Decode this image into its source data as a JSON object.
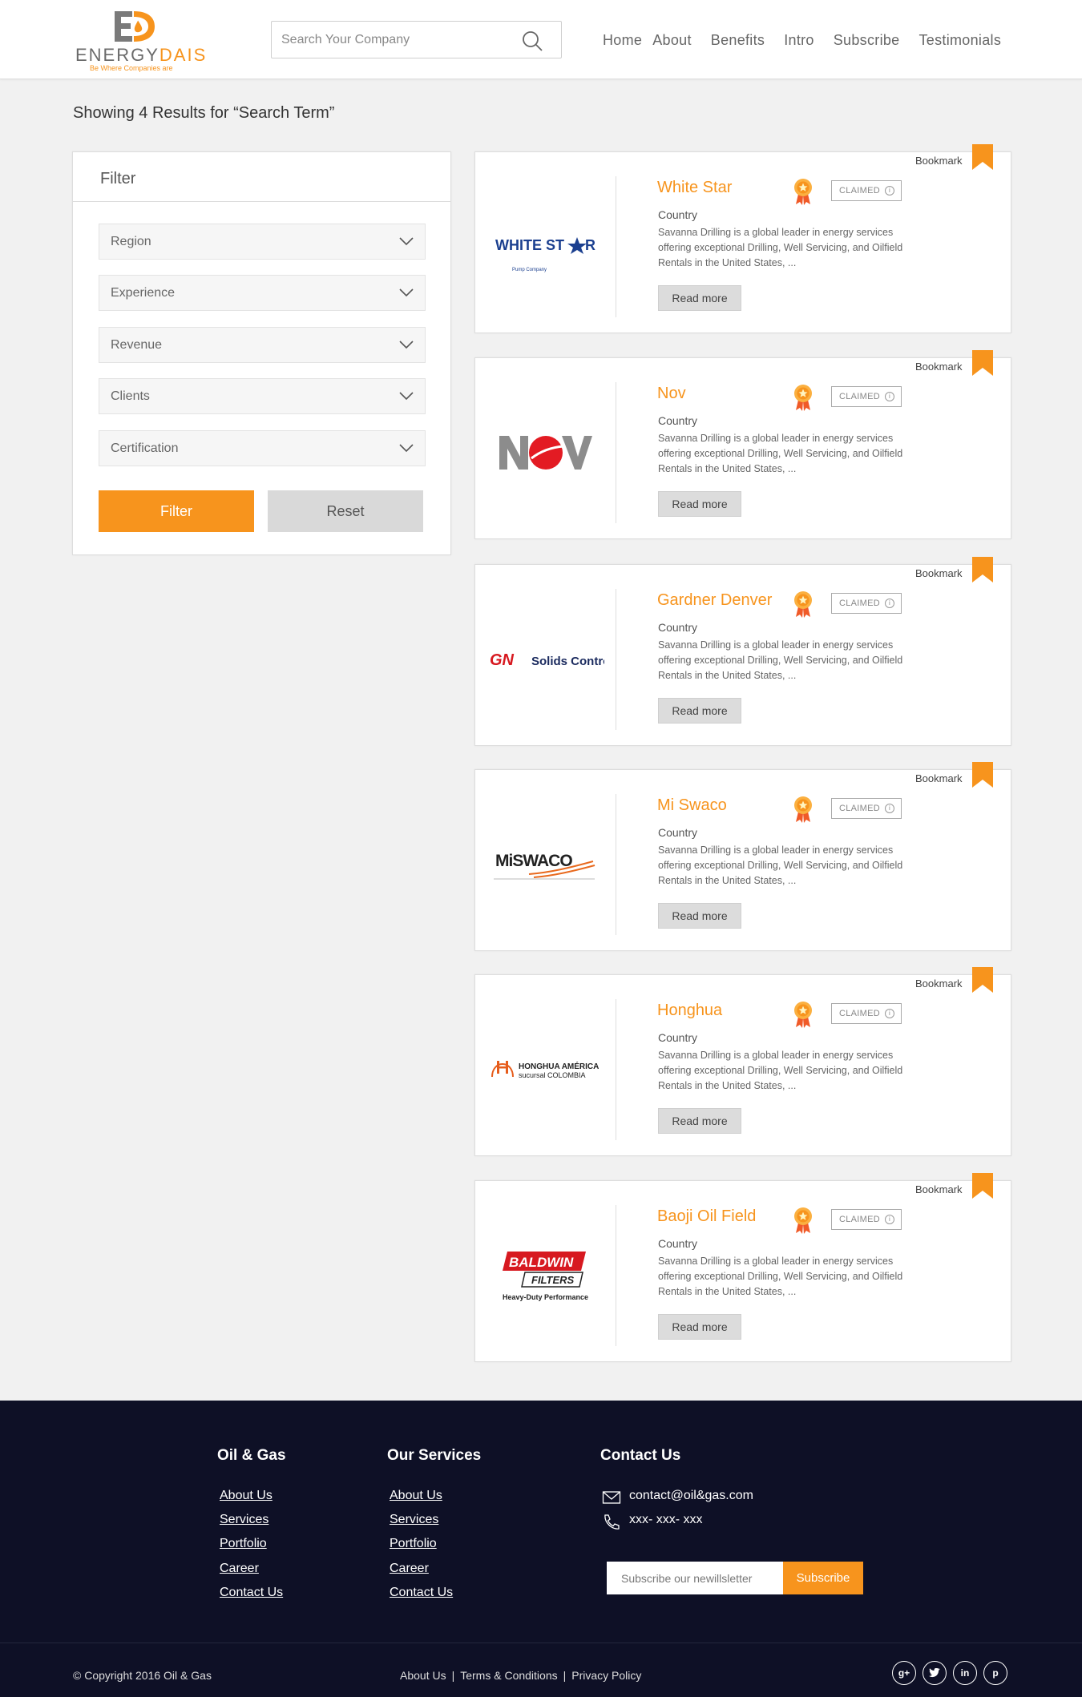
{
  "header": {
    "logo": {
      "brand_main": "ENERGY",
      "brand_accent": "DAIS",
      "tagline": "Be Where Companies are"
    },
    "search": {
      "placeholder": "Search Your Company",
      "icon": "search-icon"
    },
    "nav": [
      "Home",
      "About",
      "Benefits",
      "Intro",
      "Subscribe",
      "Testimonials"
    ]
  },
  "results_heading": "Showing 4 Results for “Search Term”",
  "filter": {
    "title": "Filter",
    "selects": [
      "Region",
      "Experience",
      "Revenue",
      "Clients",
      "Certification"
    ],
    "filter_button": "Filter",
    "reset_button": "Reset"
  },
  "cards": [
    {
      "name": "White Star",
      "country": "Country",
      "claimed": "CLAIMED",
      "bookmark": "Bookmark",
      "read_more": "Read more",
      "logo_text": "WHITE STAR",
      "logo_sub": "Pump Company",
      "description": "Savanna Drilling is a global leader in energy services offering exceptional Drilling, Well Servicing, and Oilfield Rentals in the United States, ..."
    },
    {
      "name": "Nov",
      "country": "Country",
      "claimed": "CLAIMED",
      "bookmark": "Bookmark",
      "read_more": "Read more",
      "logo_text": "NOV",
      "logo_sub": "",
      "description": "Savanna Drilling is a global leader in energy services offering exceptional Drilling, Well Servicing, and Oilfield Rentals in the United States, ..."
    },
    {
      "name": "Gardner Denver",
      "country": "Country",
      "claimed": "CLAIMED",
      "bookmark": "Bookmark",
      "read_more": "Read more",
      "logo_text": "GN",
      "logo_sub": "Solids Control",
      "description": "Savanna Drilling is a global leader in energy services offering exceptional Drilling, Well Servicing, and Oilfield Rentals in the United States, ..."
    },
    {
      "name": "Mi Swaco",
      "country": "Country",
      "claimed": "CLAIMED",
      "bookmark": "Bookmark",
      "read_more": "Read more",
      "logo_text": "MiSWACO",
      "logo_sub": "",
      "description": "Savanna Drilling is a global leader in energy services offering exceptional Drilling, Well Servicing, and Oilfield Rentals in the United States, ..."
    },
    {
      "name": "Honghua",
      "country": "Country",
      "claimed": "CLAIMED",
      "bookmark": "Bookmark",
      "read_more": "Read more",
      "logo_text": "HONGHUA AMÉRICA",
      "logo_sub": "sucursal COLOMBIA",
      "description": "Savanna Drilling is a global leader in energy services offering exceptional Drilling, Well Servicing, and Oilfield Rentals in the United States, ..."
    },
    {
      "name": "Baoji Oil Field",
      "country": "Country",
      "claimed": "CLAIMED",
      "bookmark": "Bookmark",
      "read_more": "Read more",
      "logo_text": "BALDWIN",
      "logo_sub": "FILTERS",
      "logo_sub2": "Heavy-Duty Performance",
      "description": "Savanna Drilling is a global leader in energy services offering exceptional Drilling, Well Servicing, and Oilfield Rentals in the United States, ..."
    }
  ],
  "footer": {
    "col1": {
      "title": "Oil & Gas",
      "links": [
        "About Us",
        "Services",
        "Portfolio",
        "Career",
        "Contact Us"
      ]
    },
    "col2": {
      "title": "Our Services",
      "links": [
        "About Us",
        "Services",
        "Portfolio",
        "Career",
        "Contact Us"
      ]
    },
    "contact": {
      "title": "Contact Us",
      "email": "contact@oil&gas.com",
      "phone": "xxx- xxx- xxx"
    },
    "newsletter": {
      "placeholder": "Subscribe our newillsletter",
      "button": "Subscribe"
    },
    "copyright": "© Copyright 2016 Oil & Gas",
    "legal": [
      "About Us",
      "Terms & Conditions",
      "Privacy Policy"
    ],
    "socials": [
      "google-plus-icon",
      "twitter-icon",
      "linkedin-icon",
      "pinterest-icon"
    ]
  },
  "colors": {
    "accent": "#f7941d",
    "footer_bg": "#0e1026",
    "card_border": "#dddddd"
  }
}
